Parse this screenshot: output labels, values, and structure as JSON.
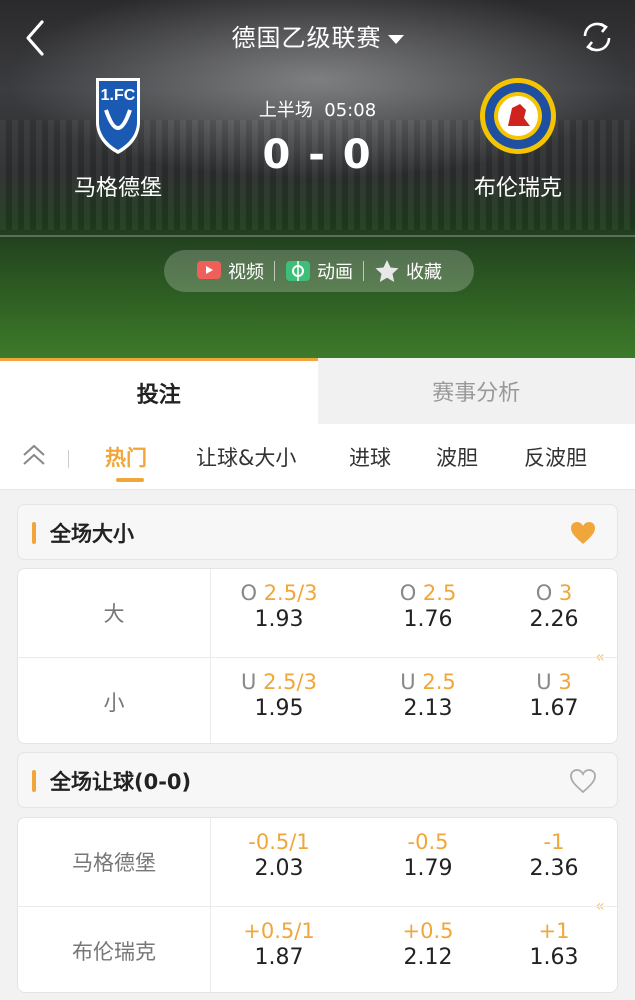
{
  "header": {
    "league": "德国乙级联赛",
    "home_team": "马格德堡",
    "away_team": "布伦瑞克",
    "period": "上半场",
    "clock": "05:08",
    "score": "0 - 0"
  },
  "media": {
    "video": "视频",
    "animation": "动画",
    "favorite": "收藏"
  },
  "main_tabs": [
    {
      "label": "投注",
      "active": true
    },
    {
      "label": "赛事分析",
      "active": false
    }
  ],
  "sub_tabs": [
    {
      "label": "热门",
      "active": true
    },
    {
      "label": "让球&大小",
      "active": false
    },
    {
      "label": "进球",
      "active": false
    },
    {
      "label": "波胆",
      "active": false
    },
    {
      "label": "反波胆",
      "active": false
    }
  ],
  "sections": [
    {
      "title": "全场大小",
      "favorited": true,
      "rows": [
        {
          "label": "大",
          "cells": [
            {
              "prefix": "O",
              "line": "2.5/3",
              "price": "1.93"
            },
            {
              "prefix": "O",
              "line": "2.5",
              "price": "1.76"
            },
            {
              "prefix": "O",
              "line": "3",
              "price": "2.26"
            }
          ]
        },
        {
          "label": "小",
          "cells": [
            {
              "prefix": "U",
              "line": "2.5/3",
              "price": "1.95"
            },
            {
              "prefix": "U",
              "line": "2.5",
              "price": "2.13"
            },
            {
              "prefix": "U",
              "line": "3",
              "price": "1.67"
            }
          ]
        }
      ]
    },
    {
      "title": "全场让球(0-0)",
      "favorited": false,
      "rows": [
        {
          "label": "马格德堡",
          "cells": [
            {
              "prefix": "",
              "line": "-0.5/1",
              "price": "2.03"
            },
            {
              "prefix": "",
              "line": "-0.5",
              "price": "1.79"
            },
            {
              "prefix": "",
              "line": "-1",
              "price": "2.36"
            }
          ]
        },
        {
          "label": "布伦瑞克",
          "cells": [
            {
              "prefix": "",
              "line": "+0.5/1",
              "price": "1.87"
            },
            {
              "prefix": "",
              "line": "+0.5",
              "price": "2.12"
            },
            {
              "prefix": "",
              "line": "+1",
              "price": "1.63"
            }
          ]
        }
      ]
    }
  ],
  "colors": {
    "accent": "#f0a63a",
    "price": "#222222",
    "muted": "#888888"
  },
  "icons": [
    "back-icon",
    "caret-down-icon",
    "refresh-icon",
    "video-icon",
    "animation-icon",
    "star-icon",
    "collapse-up-icon",
    "heart-icon",
    "scroll-hint-icon"
  ]
}
